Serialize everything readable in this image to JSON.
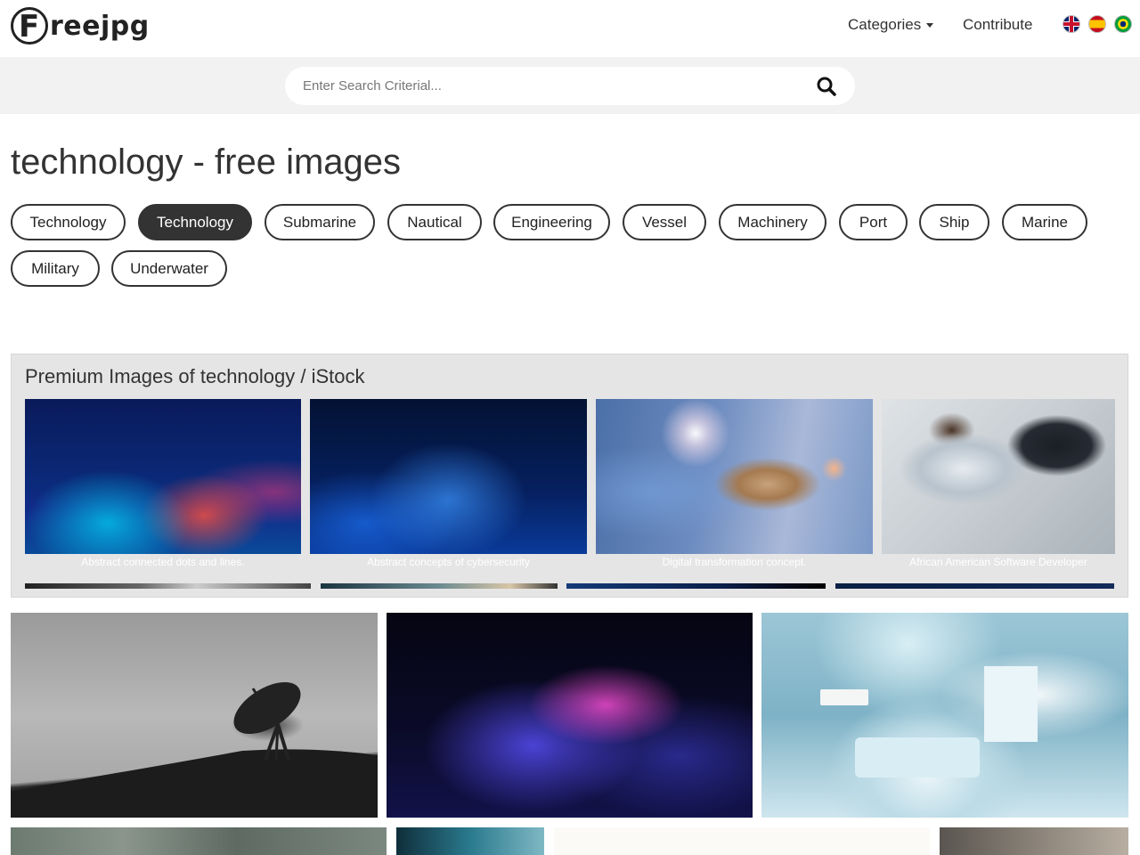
{
  "header": {
    "logo_text": "reejpg",
    "logo_letter": "F",
    "nav_categories": "Categories",
    "nav_contribute": "Contribute",
    "flags": [
      "uk-flag-icon",
      "spain-flag-icon",
      "brazil-flag-icon"
    ]
  },
  "search": {
    "placeholder": "Enter Search Criterial...",
    "value": ""
  },
  "page": {
    "title": "technology - free images"
  },
  "tags": [
    {
      "label": "Technology",
      "active": false
    },
    {
      "label": "Technology",
      "active": true
    },
    {
      "label": "Submarine",
      "active": false
    },
    {
      "label": "Nautical",
      "active": false
    },
    {
      "label": "Engineering",
      "active": false
    },
    {
      "label": "Vessel",
      "active": false
    },
    {
      "label": "Machinery",
      "active": false
    },
    {
      "label": "Port",
      "active": false
    },
    {
      "label": "Ship",
      "active": false
    },
    {
      "label": "Marine",
      "active": false
    },
    {
      "label": "Military",
      "active": false
    },
    {
      "label": "Underwater",
      "active": false
    }
  ],
  "premium": {
    "title": "Premium Images of technology / iStock",
    "items": [
      {
        "caption": "Abstract connected dots and lines."
      },
      {
        "caption": "Abstract concepts of cybersecurity"
      },
      {
        "caption": "Digital transformation concept."
      },
      {
        "caption": "African American Software Developer"
      }
    ]
  },
  "colors": {
    "tag_active_bg": "#333333",
    "search_band_bg": "#f2f2f2",
    "premium_bg": "#e5e5e5"
  }
}
